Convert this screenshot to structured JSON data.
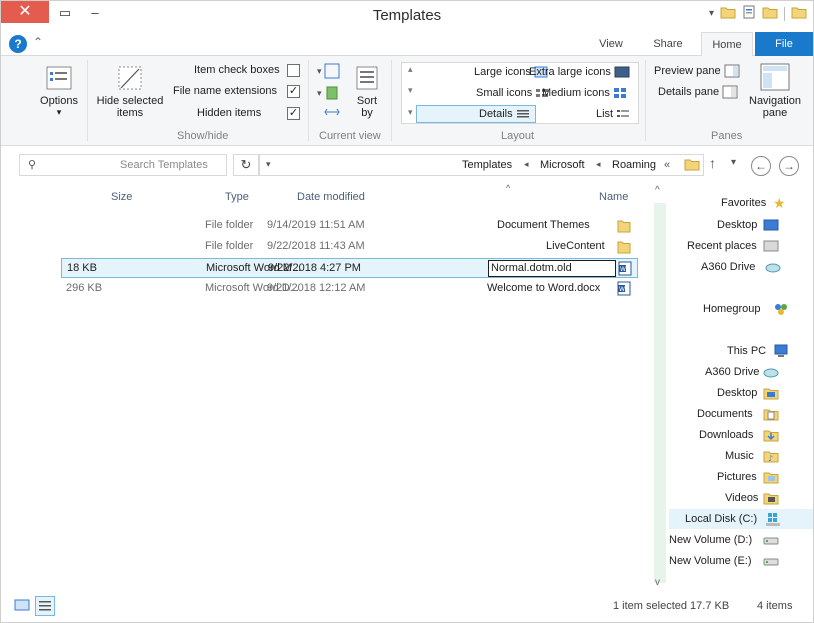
{
  "window": {
    "title": "Templates"
  },
  "qat": {
    "icons": [
      "folder-icon",
      "properties-icon",
      "new-folder-icon"
    ],
    "dropdown_icon": "chevron-down-icon"
  },
  "ribbon_tabs": {
    "file": "File",
    "home": "Home",
    "share": "Share",
    "view": "View"
  },
  "ribbon": {
    "panes": {
      "navigation_pane": "Navigation pane",
      "preview_pane": "Preview pane",
      "details_pane": "Details pane",
      "label": "Panes"
    },
    "layout": {
      "extra_large": "Extra large icons",
      "large": "Large icons",
      "medium": "Medium icons",
      "small": "Small icons",
      "list": "List",
      "details": "Details",
      "label": "Layout"
    },
    "current_view": {
      "sort_by": "Sort by",
      "label": "Current view"
    },
    "show_hide": {
      "item_checkboxes": "Item check boxes",
      "item_checkboxes_checked": false,
      "file_name_extensions": "File name extensions",
      "file_name_extensions_checked": true,
      "hidden_items": "Hidden items",
      "hidden_items_checked": true,
      "hide_selected": "Hide selected items",
      "label": "Show/hide"
    },
    "options": "Options"
  },
  "address": {
    "crumbs": [
      "Roaming",
      "Microsoft",
      "Templates"
    ],
    "overflow": "«",
    "search_placeholder": "Search Templates"
  },
  "columns": {
    "name": "Name",
    "date_modified": "Date modified",
    "type": "Type",
    "size": "Size"
  },
  "files": [
    {
      "name": "Document Themes",
      "date": "9/14/2019 11:51 AM",
      "type": "File folder",
      "size": "",
      "icon": "folder-icon"
    },
    {
      "name": "LiveContent",
      "date": "9/22/2018 11:43 AM",
      "type": "File folder",
      "size": "",
      "icon": "folder-icon"
    },
    {
      "name": "Normal.dotm.old",
      "date": "9/22/2018 4:27 PM",
      "type": "Microsoft Word M...",
      "size": "18 KB",
      "icon": "word-doc-icon",
      "renaming": true
    },
    {
      "name": "Welcome to Word.docx",
      "date": "9/21/2018 12:12 AM",
      "type": "Microsoft Word D...",
      "size": "296 KB",
      "icon": "word-doc-icon"
    }
  ],
  "nav": {
    "favorites": "Favorites",
    "favorites_items": [
      "Desktop",
      "Recent places",
      "A360 Drive"
    ],
    "homegroup": "Homegroup",
    "this_pc": "This PC",
    "pc_items": [
      "A360 Drive",
      "Desktop",
      "Documents",
      "Downloads",
      "Music",
      "Pictures",
      "Videos",
      "Local Disk (C:)",
      "New Volume (D:)",
      "New Volume (E:)"
    ]
  },
  "status": {
    "items": "4 items",
    "selected": "1 item selected  17.7 KB"
  },
  "colors": {
    "accent": "#1979ca",
    "close": "#e35c4d",
    "selection": "#e5f3fb"
  }
}
